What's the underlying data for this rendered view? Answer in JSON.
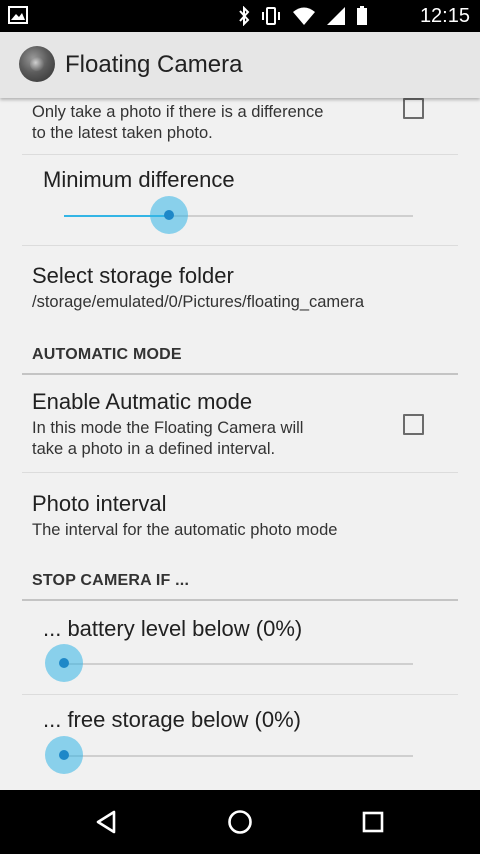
{
  "status_bar": {
    "time": "12:15",
    "icons": [
      "image-notification-icon",
      "bluetooth-icon",
      "vibrate-icon",
      "wifi-icon",
      "cell-signal-icon",
      "battery-icon"
    ]
  },
  "action_bar": {
    "title": "Floating Camera",
    "icon": "camera-lens-icon"
  },
  "settings": {
    "difference_only": {
      "summary_line1": "Only take a photo if there is a difference",
      "summary_line2": "to the latest taken photo.",
      "checked": false
    },
    "minimum_difference": {
      "label": "Minimum difference",
      "value_fraction": 0.3
    },
    "storage_folder": {
      "title": "Select storage folder",
      "path": "/storage/emulated/0/Pictures/floating_camera"
    },
    "automatic_mode_header": "AUTOMATIC MODE",
    "enable_automatic": {
      "title": "Enable Autmatic mode",
      "summary_line1": "In this mode the Floating Camera will",
      "summary_line2": "take a photo in a defined interval.",
      "checked": false
    },
    "photo_interval": {
      "title": "Photo interval",
      "summary": "The interval for the automatic photo mode"
    },
    "stop_camera_header": "STOP CAMERA IF ...",
    "battery_level": {
      "label": "... battery level below (0%)",
      "value_fraction": 0
    },
    "free_storage": {
      "label": "... free storage below (0%)",
      "value_fraction": 0
    }
  },
  "colors": {
    "accent": "#33b5e5",
    "status_bar": "#000000",
    "action_bar": "#e6e6e6",
    "background": "#f1f1f1"
  },
  "nav_bar": {
    "buttons": [
      "back-icon",
      "home-icon",
      "recents-icon"
    ]
  }
}
